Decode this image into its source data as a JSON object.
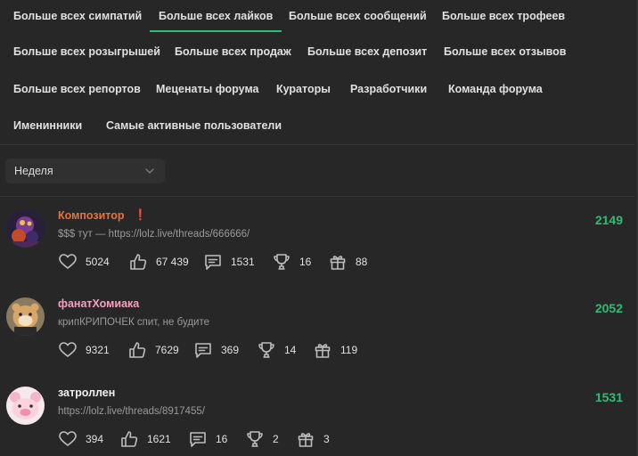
{
  "tabs": [
    "Больше всех симпатий",
    "Больше всех лайков",
    "Больше всех сообщений",
    "Больше всех трофеев",
    "Больше всех розыгрышей",
    "Больше всех продаж",
    "Больше всех депозит",
    "Больше всех отзывов",
    "Больше всех репортов",
    "Меценаты форума",
    "Кураторы",
    "Разработчики",
    "Команда форума",
    "Именинники",
    "Самые активные пользователи"
  ],
  "active_tab": "Больше всех лайков",
  "filter": {
    "selected": "Неделя"
  },
  "colors": {
    "accent": "#2dbd75",
    "background": "#272727"
  },
  "users": [
    {
      "name": "Композитор",
      "name_color": "#e8733a",
      "badge": "❗",
      "status": "$$$ тут — https://lolz.live/threads/666666/",
      "score": "2149",
      "stats": {
        "likes": "5024",
        "thumbs": "67 439",
        "messages": "1531",
        "trophies": "16",
        "gifts": "88"
      }
    },
    {
      "name": "фанатХомиака",
      "name_color": "#f2a2c0",
      "status": "крипКРИПОЧЕК спит, не будите",
      "score": "2052",
      "stats": {
        "likes": "9321",
        "thumbs": "7629",
        "messages": "369",
        "trophies": "14",
        "gifts": "119"
      }
    },
    {
      "name": "затроллен",
      "name_color": "#f0f0f0",
      "status": "https://lolz.live/threads/8917455/",
      "score": "1531",
      "stats": {
        "likes": "394",
        "thumbs": "1621",
        "messages": "16",
        "trophies": "2",
        "gifts": "3"
      }
    }
  ]
}
